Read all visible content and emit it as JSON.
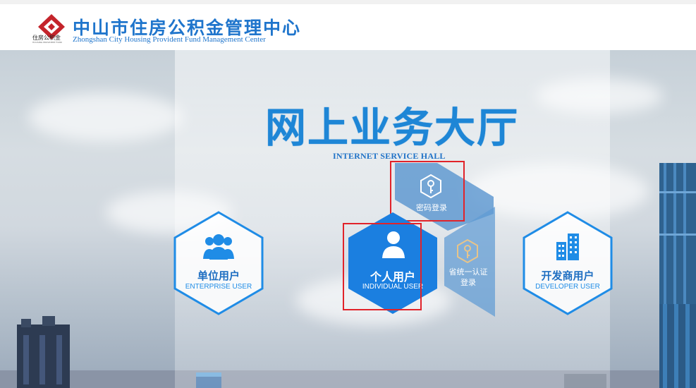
{
  "header": {
    "logo_text": "住房公积金",
    "logo_subtext": "HOUSING PROVIDENT FUND",
    "title_cn": "中山市住房公积金管理中心",
    "title_en": "Zhongshan City Housing Provident Fund Management Center"
  },
  "hero": {
    "title": "网上业务大厅",
    "subtitle": "INTERNET SERVICE HALL"
  },
  "options": {
    "enterprise": {
      "label": "单位用户",
      "label_en": "ENTERPRISE USER",
      "icon": "users-icon"
    },
    "individual": {
      "label": "个人用户",
      "label_en": "INDIVIDUAL USER",
      "icon": "user-icon"
    },
    "developer": {
      "label": "开发商用户",
      "label_en": "DEVELOPER USER",
      "icon": "building-icon"
    },
    "password_login": {
      "label": "密码登录",
      "icon": "key-icon"
    },
    "unified_login": {
      "label_line1": "省统一认证",
      "label_line2": "登录",
      "icon": "key-icon"
    }
  },
  "colors": {
    "brand_blue": "#1f75cc",
    "active_blue": "#1b7fe0",
    "highlight_red": "#e1232a",
    "logo_red": "#c4242b"
  }
}
